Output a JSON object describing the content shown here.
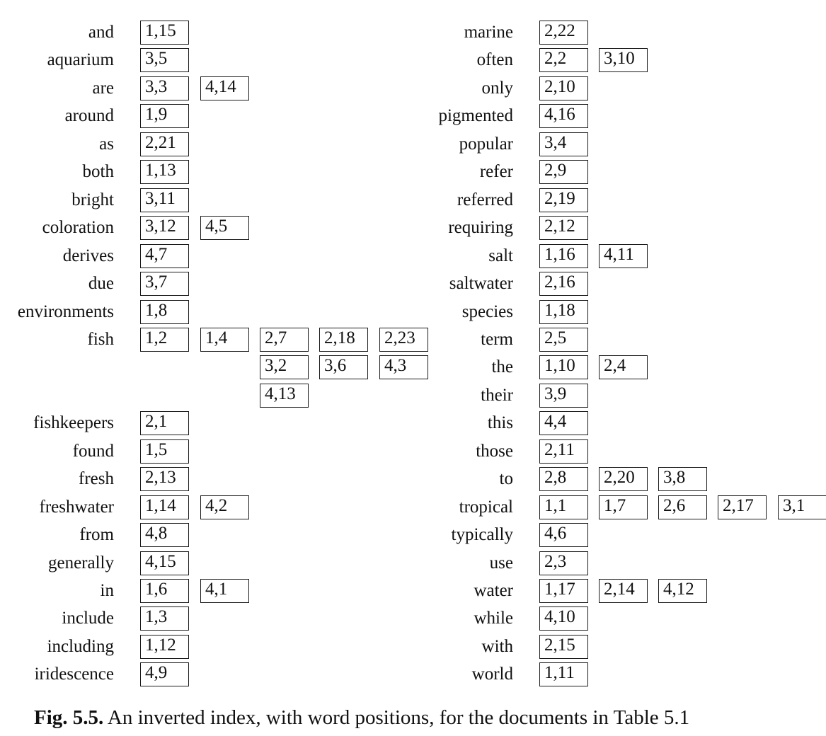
{
  "figure": {
    "caption_label": "Fig. 5.5.",
    "caption_text": " An inverted index, with word positions, for the documents in Table 5.1"
  },
  "index": {
    "left": [
      {
        "term": "and",
        "postings": [
          [
            "1,15"
          ]
        ]
      },
      {
        "term": "aquarium",
        "postings": [
          [
            "3,5"
          ]
        ]
      },
      {
        "term": "are",
        "postings": [
          [
            "3,3",
            "4,14"
          ]
        ]
      },
      {
        "term": "around",
        "postings": [
          [
            "1,9"
          ]
        ]
      },
      {
        "term": "as",
        "postings": [
          [
            "2,21"
          ]
        ]
      },
      {
        "term": "both",
        "postings": [
          [
            "1,13"
          ]
        ]
      },
      {
        "term": "bright",
        "postings": [
          [
            "3,11"
          ]
        ]
      },
      {
        "term": "coloration",
        "postings": [
          [
            "3,12",
            "4,5"
          ]
        ]
      },
      {
        "term": "derives",
        "postings": [
          [
            "4,7"
          ]
        ]
      },
      {
        "term": "due",
        "postings": [
          [
            "3,7"
          ]
        ]
      },
      {
        "term": "environments",
        "postings": [
          [
            "1,8"
          ]
        ]
      },
      {
        "term": "fish",
        "postings": [
          [
            "1,2",
            "1,4",
            "2,7",
            "2,18",
            "2,23"
          ],
          [
            "",
            "",
            "3,2",
            "3,6",
            "4,3"
          ],
          [
            "",
            "",
            "4,13"
          ]
        ]
      },
      {
        "term": "fishkeepers",
        "postings": [
          [
            "2,1"
          ]
        ]
      },
      {
        "term": "found",
        "postings": [
          [
            "1,5"
          ]
        ]
      },
      {
        "term": "fresh",
        "postings": [
          [
            "2,13"
          ]
        ]
      },
      {
        "term": "freshwater",
        "postings": [
          [
            "1,14",
            "4,2"
          ]
        ]
      },
      {
        "term": "from",
        "postings": [
          [
            "4,8"
          ]
        ]
      },
      {
        "term": "generally",
        "postings": [
          [
            "4,15"
          ]
        ]
      },
      {
        "term": "in",
        "postings": [
          [
            "1,6",
            "4,1"
          ]
        ]
      },
      {
        "term": "include",
        "postings": [
          [
            "1,3"
          ]
        ]
      },
      {
        "term": "including",
        "postings": [
          [
            "1,12"
          ]
        ]
      },
      {
        "term": "iridescence",
        "postings": [
          [
            "4,9"
          ]
        ]
      }
    ],
    "right": [
      {
        "term": "marine",
        "postings": [
          [
            "2,22"
          ]
        ]
      },
      {
        "term": "often",
        "postings": [
          [
            "2,2",
            "3,10"
          ]
        ]
      },
      {
        "term": "only",
        "postings": [
          [
            "2,10"
          ]
        ]
      },
      {
        "term": "pigmented",
        "postings": [
          [
            "4,16"
          ]
        ]
      },
      {
        "term": "popular",
        "postings": [
          [
            "3,4"
          ]
        ]
      },
      {
        "term": "refer",
        "postings": [
          [
            "2,9"
          ]
        ]
      },
      {
        "term": "referred",
        "postings": [
          [
            "2,19"
          ]
        ]
      },
      {
        "term": "requiring",
        "postings": [
          [
            "2,12"
          ]
        ]
      },
      {
        "term": "salt",
        "postings": [
          [
            "1,16",
            "4,11"
          ]
        ]
      },
      {
        "term": "saltwater",
        "postings": [
          [
            "2,16"
          ]
        ]
      },
      {
        "term": "species",
        "postings": [
          [
            "1,18"
          ]
        ]
      },
      {
        "term": "term",
        "postings": [
          [
            "2,5"
          ]
        ]
      },
      {
        "term": "the",
        "postings": [
          [
            "1,10",
            "2,4"
          ]
        ]
      },
      {
        "term": "their",
        "postings": [
          [
            "3,9"
          ]
        ]
      },
      {
        "term": "this",
        "postings": [
          [
            "4,4"
          ]
        ]
      },
      {
        "term": "those",
        "postings": [
          [
            "2,11"
          ]
        ]
      },
      {
        "term": "to",
        "postings": [
          [
            "2,8",
            "2,20",
            "3,8"
          ]
        ]
      },
      {
        "term": "tropical",
        "postings": [
          [
            "1,1",
            "1,7",
            "2,6",
            "2,17",
            "3,1"
          ]
        ]
      },
      {
        "term": "typically",
        "postings": [
          [
            "4,6"
          ]
        ]
      },
      {
        "term": "use",
        "postings": [
          [
            "2,3"
          ]
        ]
      },
      {
        "term": "water",
        "postings": [
          [
            "1,17",
            "2,14",
            "4,12"
          ]
        ]
      },
      {
        "term": "while",
        "postings": [
          [
            "4,10"
          ]
        ]
      },
      {
        "term": "with",
        "postings": [
          [
            "2,15"
          ]
        ]
      },
      {
        "term": "world",
        "postings": [
          [
            "1,11"
          ]
        ]
      }
    ]
  }
}
